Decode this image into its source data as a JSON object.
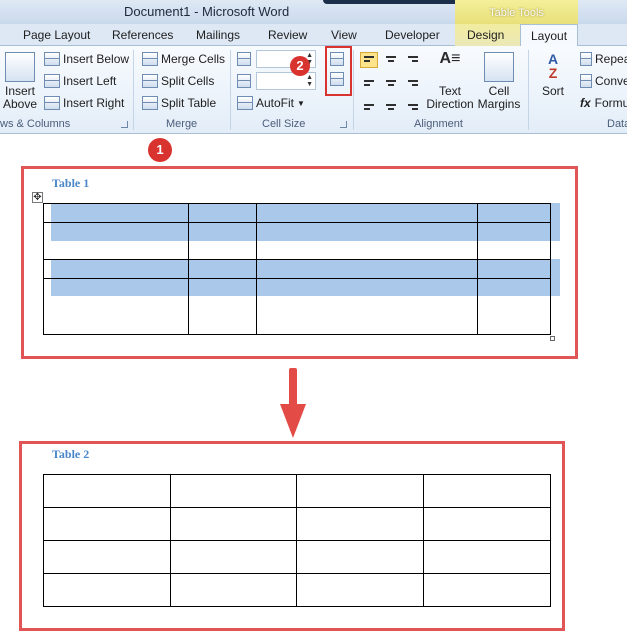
{
  "window": {
    "title": "Document1  -  Microsoft Word",
    "contextual_tab_group": "Table Tools"
  },
  "tabs": [
    "Page Layout",
    "References",
    "Mailings",
    "Review",
    "View",
    "Developer",
    "Design",
    "Layout"
  ],
  "ribbon": {
    "rows_columns": {
      "insert_above": "Insert\nAbove",
      "insert_below": "Insert Below",
      "insert_left": "Insert Left",
      "insert_right": "Insert Right",
      "label": "ws & Columns"
    },
    "merge": {
      "merge_cells": "Merge Cells",
      "split_cells": "Split Cells",
      "split_table": "Split Table",
      "label": "Merge"
    },
    "cell_size": {
      "height_value": "",
      "width_value": "",
      "autofit": "AutoFit",
      "label": "Cell Size"
    },
    "alignment": {
      "text_direction": "Text\nDirection",
      "cell_margins": "Cell\nMargins",
      "label": "Alignment"
    },
    "data": {
      "sort": "Sort",
      "repeat": "Repea",
      "convert": "Conve",
      "formula": "Formu",
      "label": "Data"
    }
  },
  "callouts": {
    "one": "1",
    "two": "2"
  },
  "document": {
    "table1_caption": "Table 1",
    "table2_caption": "Table 2"
  },
  "colors": {
    "accent_red": "#d9332f",
    "selection": "#a9c8ea",
    "caption_blue": "#4a86c8"
  }
}
